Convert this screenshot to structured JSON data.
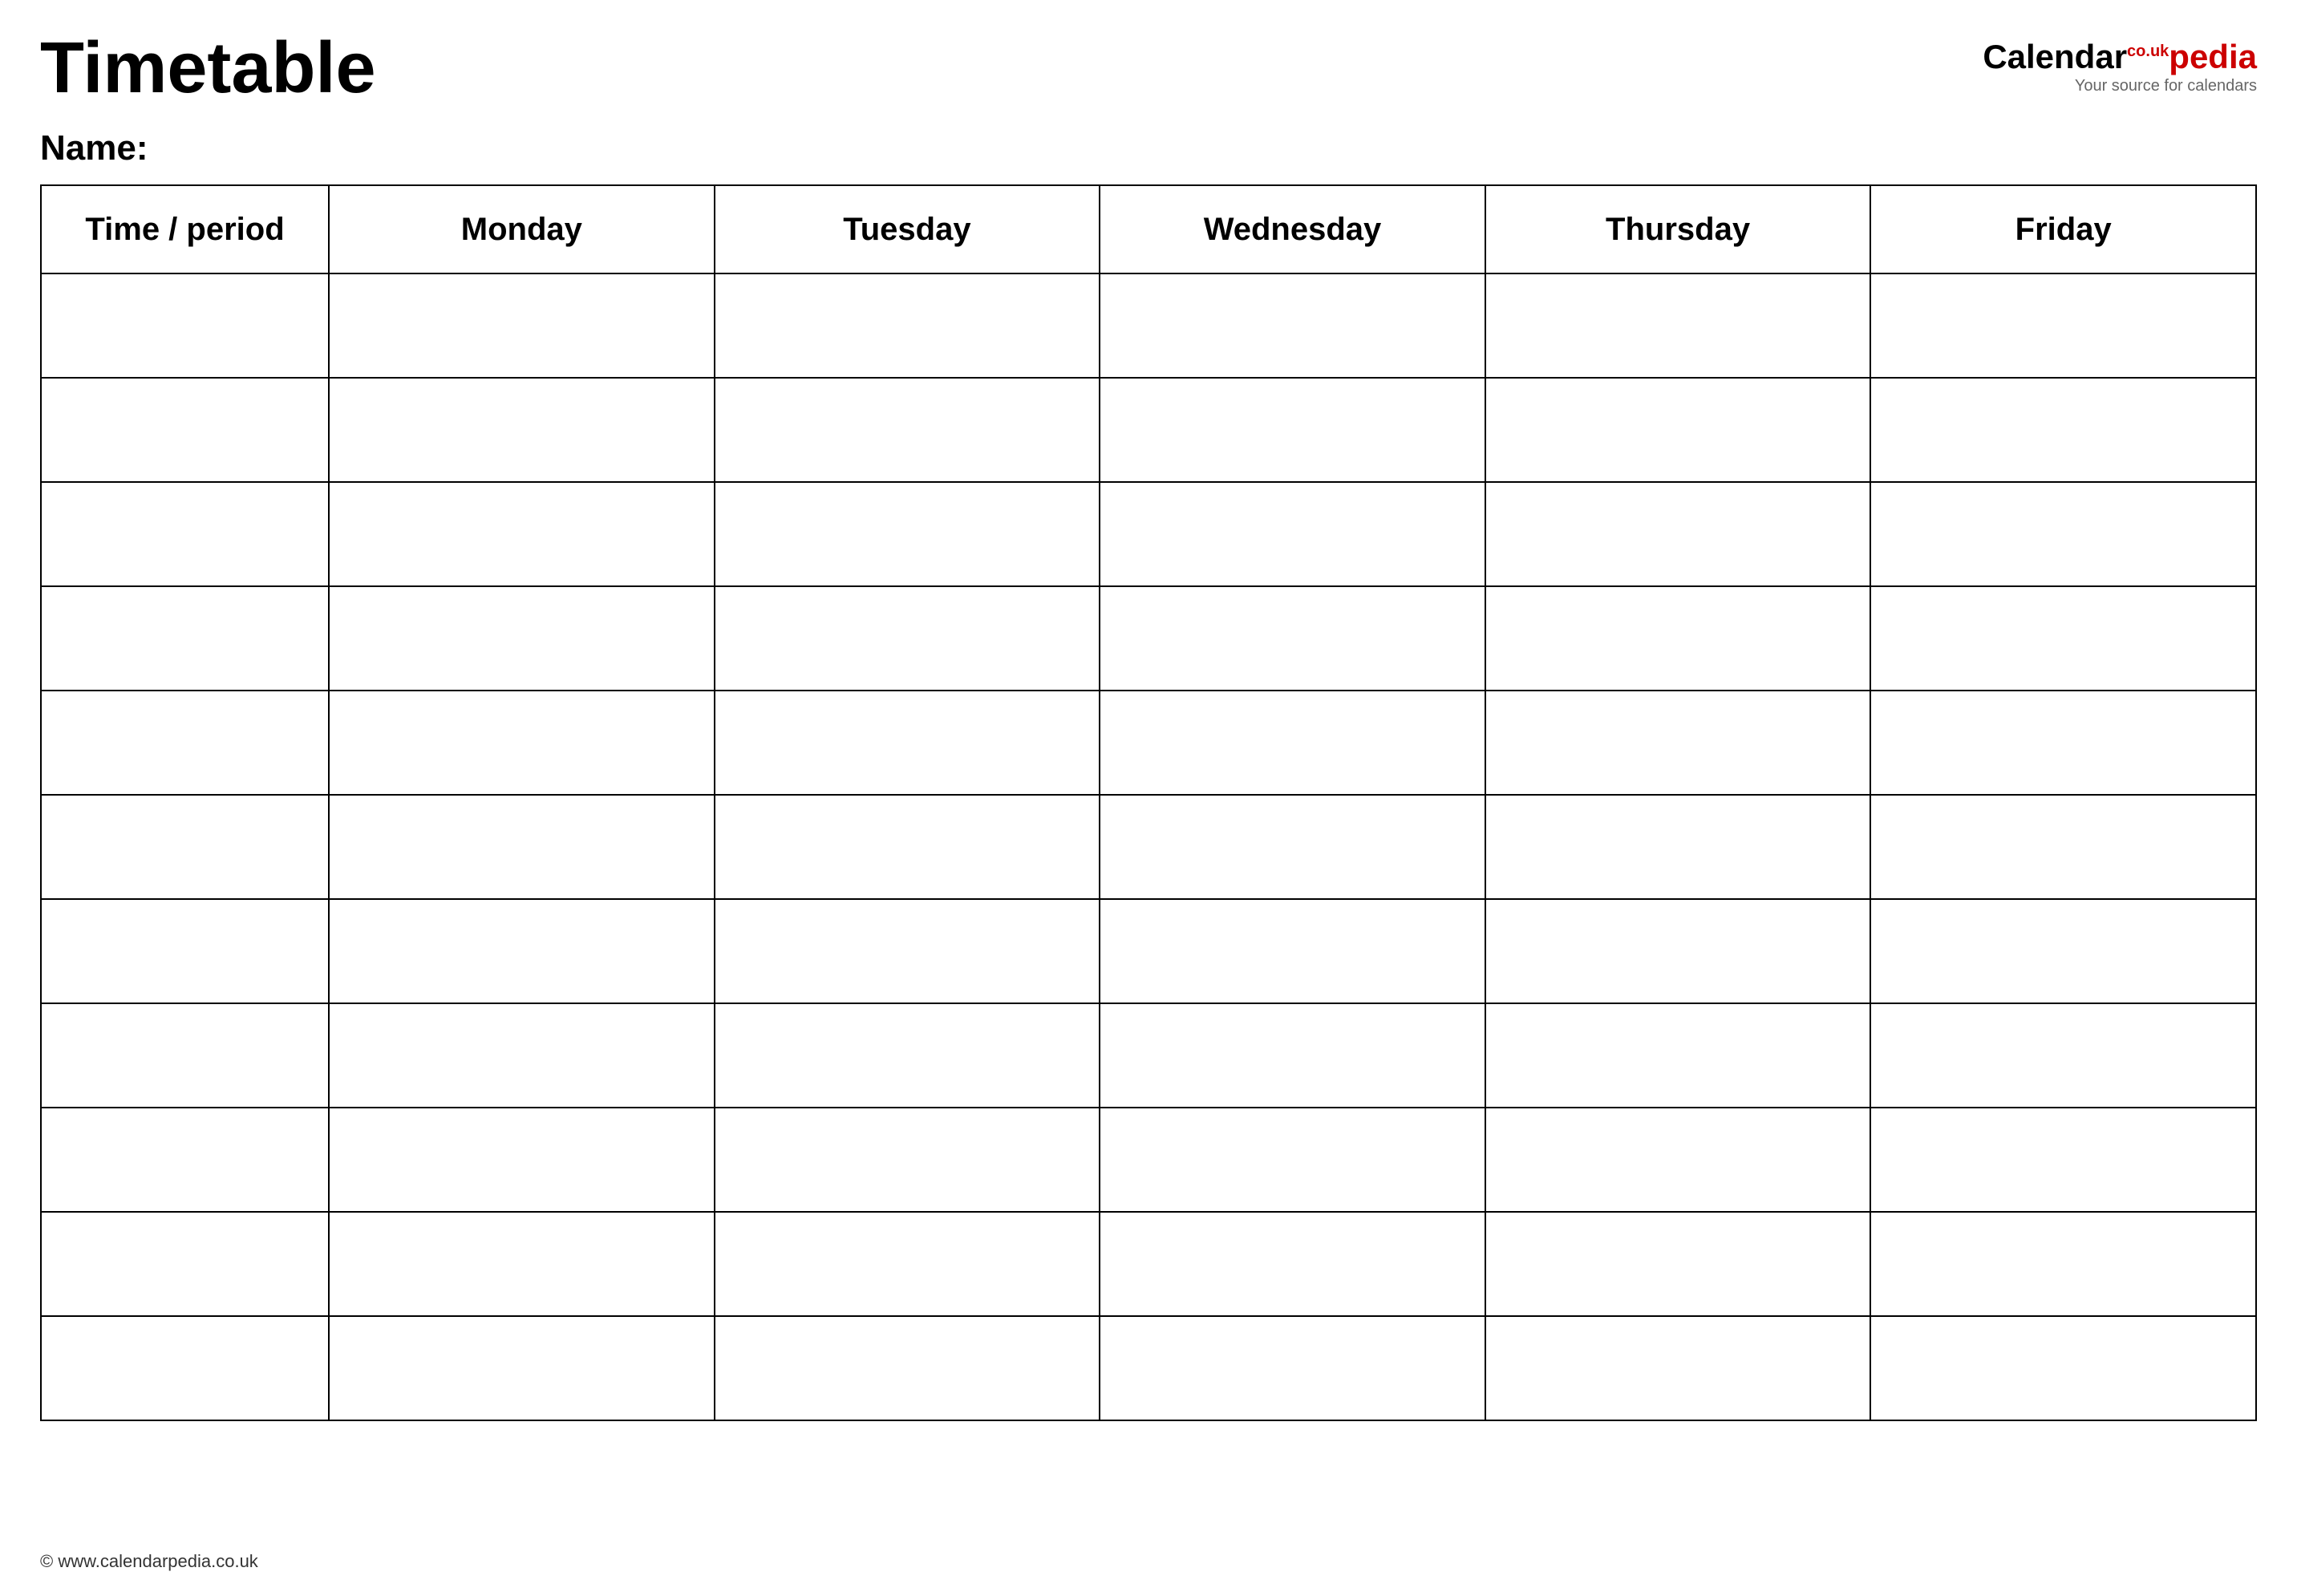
{
  "header": {
    "title": "Timetable",
    "logo": {
      "calendar_text": "Calendar",
      "pedia_text": "pedia",
      "co_text": "co.uk",
      "tagline": "Your source for calendars"
    }
  },
  "name_label": "Name:",
  "table": {
    "columns": [
      "Time / period",
      "Monday",
      "Tuesday",
      "Wednesday",
      "Thursday",
      "Friday"
    ],
    "row_count": 11
  },
  "footer": {
    "url": "© www.calendarpedia.co.uk"
  }
}
